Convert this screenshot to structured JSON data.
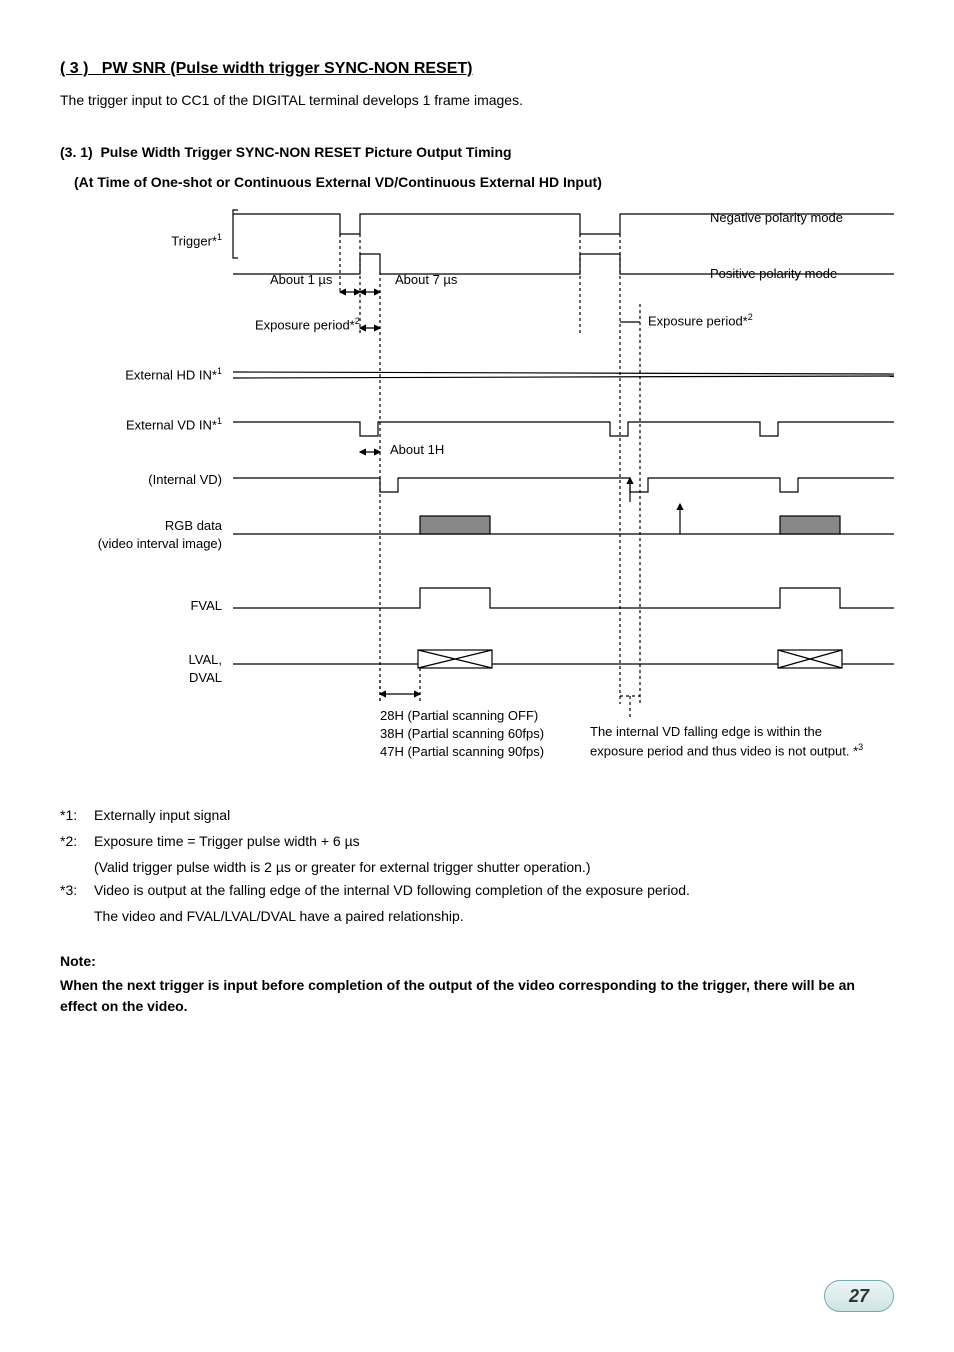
{
  "section": {
    "number": "( 3 )",
    "title": "PW SNR (Pulse width trigger SYNC-NON RESET)",
    "intro": "The trigger input to CC1 of the DIGITAL terminal develops 1 frame images."
  },
  "subsection": {
    "number": "(3. 1)",
    "title": "Pulse Width Trigger SYNC-NON RESET Picture Output Timing",
    "subtitle": "(At Time of One-shot or Continuous External VD/Continuous External HD Input)"
  },
  "diagram": {
    "rows": {
      "trigger": "Trigger*",
      "trigger_sup": "1",
      "hd": "External HD IN*",
      "hd_sup": "1",
      "vd": "External VD IN*",
      "vd_sup": "1",
      "ivd": "(Internal VD)",
      "rgb1": "RGB data",
      "rgb2": "(video interval image)",
      "fval": "FVAL",
      "lval1": "LVAL,",
      "lval2": "DVAL"
    },
    "annotations": {
      "neg_mode": "Negative polarity mode",
      "pos_mode": "Positive polarity mode",
      "about1": "About 1 µs",
      "about7": "About 7 µs",
      "exp_left": "Exposure period*",
      "exp_left_sup": "2",
      "exp_right": "Exposure period*",
      "exp_right_sup": "2",
      "about1h": "About 1H",
      "scan1": "28H (Partial scanning OFF)",
      "scan2": "38H (Partial scanning 60fps)",
      "scan3": "47H (Partial scanning 90fps)",
      "right_note1": "The internal VD falling edge is within the",
      "right_note2": "exposure period and thus video is not output. *",
      "right_note2_sup": "3"
    }
  },
  "footnotes": {
    "f1_tag": "*1:",
    "f1": "Externally input signal",
    "f2_tag": "*2:",
    "f2a": "Exposure time = Trigger pulse width + 6 µs",
    "f2b": "(Valid trigger pulse width is 2 µs or greater for external trigger shutter operation.)",
    "f3_tag": "*3:",
    "f3a": "Video is output at the falling edge of the internal VD following completion of the exposure period.",
    "f3b": "The video and FVAL/LVAL/DVAL have a paired relationship."
  },
  "note": {
    "heading": "Note:",
    "body": "When the next trigger is input before completion of the output of the video corresponding to the trigger, there will be an effect on the video."
  },
  "page_number": "27"
}
